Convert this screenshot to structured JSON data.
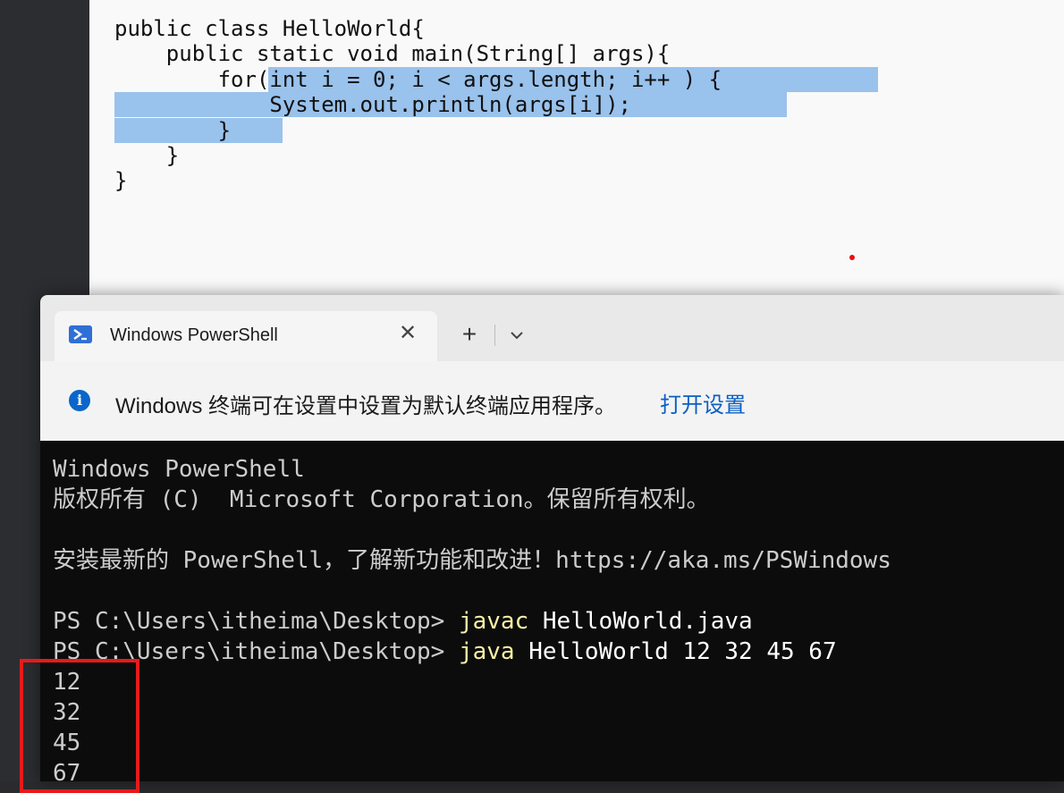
{
  "editor": {
    "code_lines": [
      "public class HelloWorld{",
      "    public static void main(String[] args){",
      "        for(int i = 0; i < args.length; i++ ) {",
      "            System.out.println(args[i]);",
      "        }",
      "    }",
      "}"
    ]
  },
  "terminal": {
    "tab_title": "Windows PowerShell",
    "tab_close": "✕",
    "new_tab": "+",
    "info_text": "Windows 终端可在设置中设置为默认终端应用程序。",
    "info_link": "打开设置",
    "console": {
      "banner": "Windows PowerShell",
      "copyright": "版权所有 (C)  Microsoft Corporation。保留所有权利。",
      "blank1": "",
      "install_msg": "安装最新的 PowerShell，了解新功能和改进！https://aka.ms/PSWindows",
      "blank2": "",
      "prompt1": "PS C:\\Users\\itheima\\Desktop> ",
      "cmd1": "javac",
      "args1": " HelloWorld.java",
      "prompt2": "PS C:\\Users\\itheima\\Desktop> ",
      "cmd2": "java",
      "args2": " HelloWorld 12 32 45 67",
      "outputs": [
        "12",
        "32",
        "45",
        "67"
      ]
    }
  },
  "colors": {
    "selection": "#99c2ec",
    "command_yellow": "#f9f1a5",
    "annotation_red": "#e51b1b",
    "accent_blue": "#0a5fc5"
  }
}
